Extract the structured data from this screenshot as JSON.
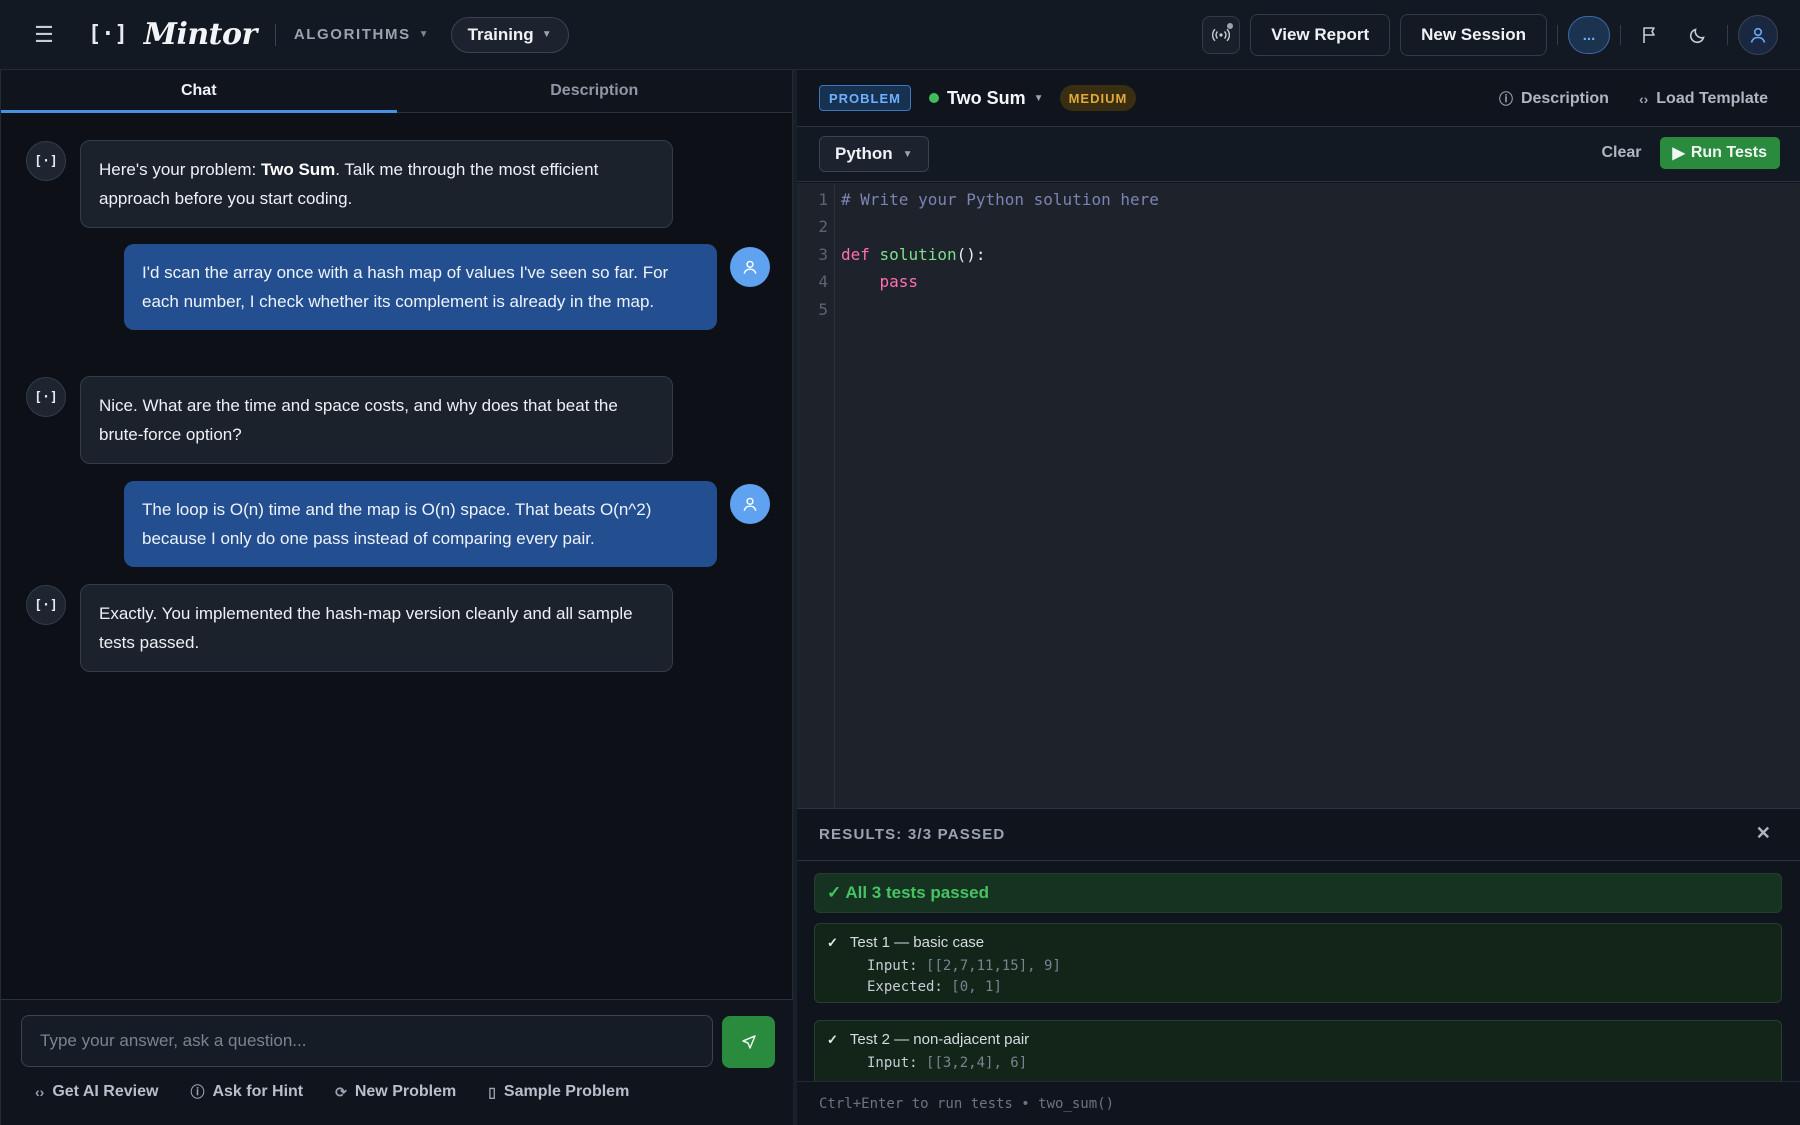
{
  "header": {
    "logo_mark": "[·]",
    "brand": "Mintor",
    "section": "ALGORITHMS",
    "mode": "Training",
    "view_report": "View Report",
    "new_session": "New Session",
    "more": "..."
  },
  "left": {
    "tabs": [
      {
        "label": "Chat"
      },
      {
        "label": "Description"
      }
    ],
    "bot_avatar": "[·]",
    "messages": [
      {
        "role": "bot",
        "pre": "Here's your problem: ",
        "bold": "Two Sum",
        "post": ". Talk me through the most efficient approach before you start coding."
      },
      {
        "role": "user",
        "text": "I'd scan the array once with a hash map of values I've seen so far. For each number, I check whether its complement is already in the map."
      },
      {
        "role": "bot",
        "text": "Nice. What are the time and space costs, and why does that beat the brute-force option?"
      },
      {
        "role": "user",
        "text": "The loop is O(n) time and the map is O(n) space. That beats O(n^2) because I only do one pass instead of comparing every pair."
      },
      {
        "role": "bot",
        "text": "Exactly. You implemented the hash-map version cleanly and all sample tests passed."
      }
    ],
    "composer": {
      "placeholder": "Type your answer, ask a question...",
      "actions": [
        {
          "label": "Get AI Review",
          "icon": "code-icon"
        },
        {
          "label": "Ask for Hint",
          "icon": "help-circle-icon"
        },
        {
          "label": "New Problem",
          "icon": "refresh-icon"
        },
        {
          "label": "Sample Problem",
          "icon": "document-icon"
        }
      ]
    }
  },
  "problem": {
    "badge": "PROBLEM",
    "title": "Two Sum",
    "difficulty": "MEDIUM",
    "description_link": "Description",
    "load_template": "Load Template"
  },
  "editor": {
    "language": "Python",
    "clear": "Clear",
    "run": "Run Tests",
    "line_numbers": [
      "1",
      "2",
      "3",
      "4",
      "5"
    ],
    "code": {
      "comment": "# Write your Python solution here",
      "kw_def": "def",
      "fn_name": "solution",
      "sig_rest": "():",
      "kw_pass": "pass"
    }
  },
  "results": {
    "header": "RESULTS: 3/3 PASSED",
    "summary": "✓ All 3 tests passed",
    "tests": [
      {
        "title": "Test 1 — basic case",
        "input_label": "Input:",
        "input": "[[2,7,11,15], 9]",
        "expected_label": "Expected:",
        "expected": "[0, 1]"
      },
      {
        "title": "Test 2 — non-adjacent pair",
        "input_label": "Input:",
        "input": "[[3,2,4], 6]"
      }
    ],
    "footer_hint": "Ctrl+Enter to run tests • two_sum()"
  },
  "colors": {
    "accent": "#4a90e2",
    "user_bubble": "#234f91",
    "success": "#2a8a3e",
    "difficulty": "#e0a93a"
  }
}
